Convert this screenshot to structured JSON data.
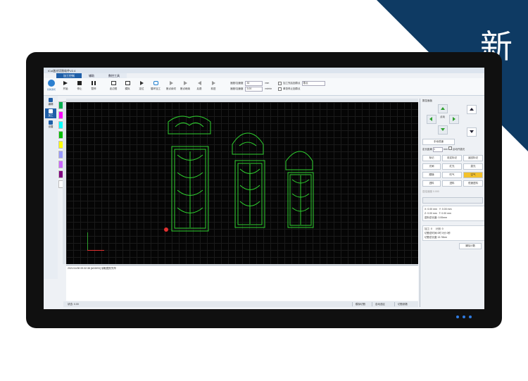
{
  "badge": {
    "text": "新"
  },
  "app": {
    "title": "iCut激光切割软件V2.4"
  },
  "tabs": [
    {
      "label": "加工控制",
      "active": true
    },
    {
      "label": "辅助",
      "active": false
    },
    {
      "label": "数控工具",
      "active": false
    }
  ],
  "logo": {
    "text": "长新激光"
  },
  "toolbar": {
    "start": "开始",
    "stop": "停止",
    "pause": "暂停",
    "frame": "走边框",
    "simulate": "模拟",
    "locate": "定位",
    "loop": "循环加工",
    "resume": "断点续切",
    "breakpoint": "断点继续",
    "back": "后退",
    "forward": "前进"
  },
  "speed": {
    "label1": "速度/加速度",
    "value1": "30",
    "unit1": "mm",
    "label2": "速度/加速度",
    "value2": "3.00",
    "unit2": "m/min"
  },
  "options": {
    "opt1": "加工完后回原点",
    "opt1_select": "零点",
    "opt2": "单张停止回原点"
  },
  "sidebar": [
    {
      "label": "编辑",
      "active": false
    },
    {
      "label": "加工",
      "active": true
    },
    {
      "label": "设置",
      "active": false
    }
  ],
  "palette": [
    "#00b050",
    "#ff00ff",
    "#00ffff",
    "#00c000",
    "#ffff00",
    "#9999ff",
    "#cc66ff",
    "#800080",
    "#ffffff"
  ],
  "log": {
    "line": "2021/11/08 09:32:38 [ADDED] 读取图形完毕"
  },
  "status": {
    "label": "状态:",
    "value": "0.00",
    "btn1": "模拟切割",
    "btn2": "自动选区",
    "btn3": "切割参数"
  },
  "right": {
    "title": "数控面板",
    "dot": "点动",
    "manual": "手动低速",
    "step_label": "定长距离",
    "step_value": "1",
    "step_unit": "mm",
    "step_check": "点动开激光",
    "buttons": [
      "标记",
      "设定标记",
      "返回标记",
      "光闸",
      "红光",
      "激光",
      "跟随",
      "吹气",
      "空气",
      "进料",
      "进料",
      "低速进料"
    ],
    "highlight": "空气",
    "dim_label": "进给速度",
    "dim_value": "0.000",
    "coords": [
      {
        "a": "X: 0.00",
        "au": "mm",
        "b": "Y: 0.00",
        "bu": "mm"
      },
      {
        "a": "Z: 0.00",
        "au": "mm",
        "b": "T: 0.00",
        "bu": "mm"
      }
    ],
    "progress": "进料总长度: 0.00mm",
    "info1": [
      {
        "a": "加工: 0",
        "b": "计划: 0"
      }
    ],
    "info2": [
      {
        "k": "切割总时间",
        "v": "0时 0分 0秒"
      },
      {
        "k": "切割总长度",
        "v": "13.76km"
      }
    ],
    "clear": "清除计数"
  }
}
